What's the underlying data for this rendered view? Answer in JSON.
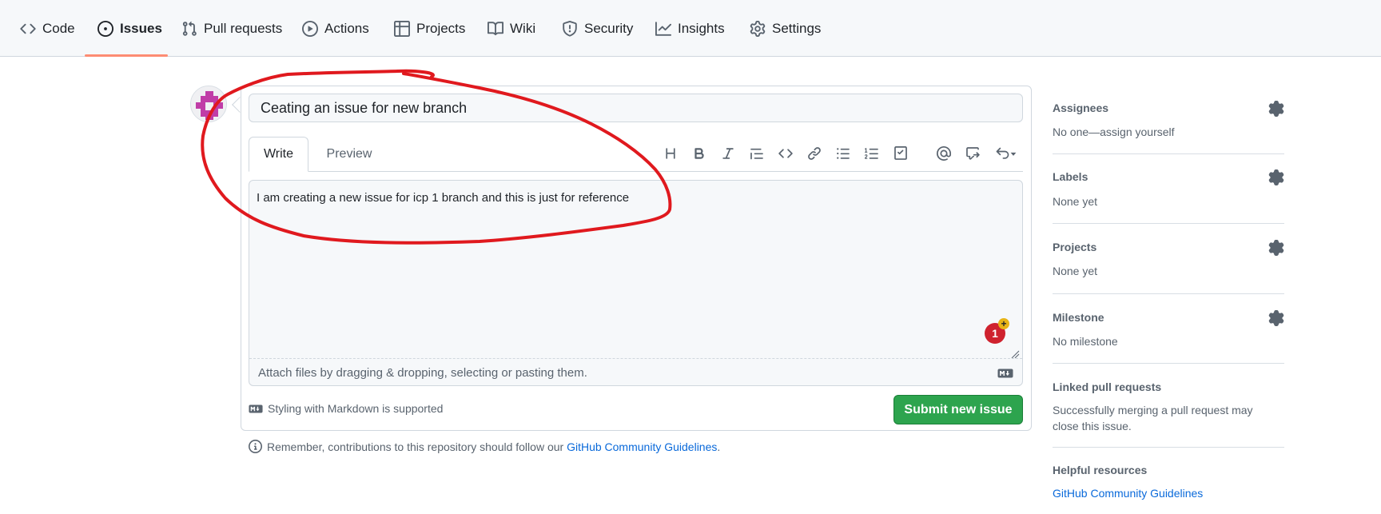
{
  "nav": {
    "tabs": [
      {
        "label": "Code",
        "icon": "code-icon"
      },
      {
        "label": "Issues",
        "icon": "issue-opened-icon",
        "active": true
      },
      {
        "label": "Pull requests",
        "icon": "git-pull-request-icon"
      },
      {
        "label": "Actions",
        "icon": "play-icon"
      },
      {
        "label": "Projects",
        "icon": "table-icon"
      },
      {
        "label": "Wiki",
        "icon": "book-icon"
      },
      {
        "label": "Security",
        "icon": "shield-icon"
      },
      {
        "label": "Insights",
        "icon": "graph-icon"
      },
      {
        "label": "Settings",
        "icon": "gear-icon"
      }
    ]
  },
  "form": {
    "title_value": "Ceating an issue for new branch",
    "tabs": {
      "write": "Write",
      "preview": "Preview"
    },
    "body_text": "I am creating a new issue for icp 1 branch and this is just for reference",
    "attach_hint": "Attach files by dragging & dropping, selecting or pasting them.",
    "markdown_note": "Styling with Markdown is supported",
    "submit_label": "Submit new issue",
    "notification_count": "1",
    "remember_text": "Remember, contributions to this repository should follow our ",
    "remember_link": "GitHub Community Guidelines",
    "remember_end": "."
  },
  "toolbar": [
    "heading-icon",
    "bold-icon",
    "italic-icon",
    "quote-icon",
    "code-icon",
    "link-icon",
    "unordered-list-icon",
    "ordered-list-icon",
    "tasklist-icon",
    "mention-icon",
    "cross-reference-icon",
    "undo-icon"
  ],
  "sidebar": {
    "assignees": {
      "heading": "Assignees",
      "value": "No one—assign yourself"
    },
    "labels": {
      "heading": "Labels",
      "value": "None yet"
    },
    "projects": {
      "heading": "Projects",
      "value": "None yet"
    },
    "milestone": {
      "heading": "Milestone",
      "value": "No milestone"
    },
    "linked_prs": {
      "heading": "Linked pull requests",
      "value": "Successfully merging a pull request may close this issue."
    },
    "helpful": {
      "heading": "Helpful resources",
      "link": "GitHub Community Guidelines"
    }
  },
  "colors": {
    "accent_underline": "#fd8c73",
    "submit_green": "#2da44e",
    "link_blue": "#0969da",
    "annotation_red": "#e0191e"
  }
}
